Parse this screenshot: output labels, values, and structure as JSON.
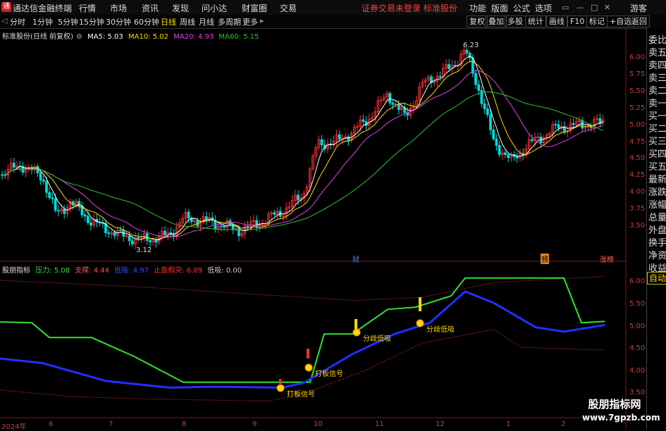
{
  "menubar": {
    "app_name": "通达信金融终端",
    "items": [
      "行情",
      "市场",
      "资讯",
      "发现",
      "问小达",
      "财富圈",
      "交易"
    ],
    "message": "证券交易未登录  标准股份",
    "right_items": [
      "功能",
      "版面",
      "公式",
      "选项"
    ],
    "guest": "游客"
  },
  "periods": {
    "tabs": [
      "分时",
      "1分钟",
      "5分钟",
      "15分钟",
      "30分钟",
      "60分钟",
      "日线",
      "周线",
      "月线",
      "多周期",
      "更多"
    ],
    "active": "日线"
  },
  "toolbar": [
    "复权",
    "叠加",
    "多股",
    "统计",
    "画线",
    "F10",
    "标记",
    "+自选",
    "返回"
  ],
  "main_chart": {
    "title": "标准股份(日线 前复权)",
    "ma": [
      {
        "label": "MA5: 5.03",
        "color": "#ffffff"
      },
      {
        "label": "MA10: 5.02",
        "color": "#ffd700"
      },
      {
        "label": "MA20: 4.93",
        "color": "#e040e0"
      },
      {
        "label": "MA60: 5.15",
        "color": "#30c030"
      }
    ],
    "y_ticks": [
      "6.00",
      "5.75",
      "5.50",
      "5.25",
      "5.00",
      "4.75",
      "4.50",
      "4.25",
      "4.00",
      "3.75",
      "3.50"
    ],
    "high_label": "6.23",
    "low_label": "3.12",
    "markers": [
      "财",
      "预",
      "涨榜"
    ]
  },
  "indicator": {
    "name": "股朋指标",
    "values": [
      {
        "label": "压力: 5.08",
        "color": "#30e030"
      },
      {
        "label": "支撑: 4.44",
        "color": "#ff5050"
      },
      {
        "label": "低吸: 4.97",
        "color": "#3050ff"
      },
      {
        "label": "止盈假突: 6.09",
        "color": "#ff3030"
      },
      {
        "label": "低吸: 0.00",
        "color": "#cccccc"
      }
    ],
    "y_ticks": [
      "6.00",
      "5.50",
      "5.00",
      "4.50",
      "4.00",
      "3.50"
    ],
    "signals": [
      "打板信号",
      "打板信号",
      "分歧低吸",
      "分歧低吸"
    ]
  },
  "x_axis": [
    "2024年",
    "6",
    "7",
    "8",
    "9",
    "10",
    "11",
    "12",
    "1",
    "2"
  ],
  "sidebar": [
    "委比",
    "卖五",
    "卖四",
    "卖三",
    "卖二",
    "卖一",
    "买一",
    "买二",
    "买三",
    "买四",
    "买五",
    "最新",
    "涨跌",
    "涨幅",
    "总量",
    "外盘",
    "换手",
    "净资",
    "收益"
  ],
  "sidebar_active": "自动",
  "watermark": {
    "line1": "股朋指标网",
    "line2": "www.7gpzb.com"
  }
}
